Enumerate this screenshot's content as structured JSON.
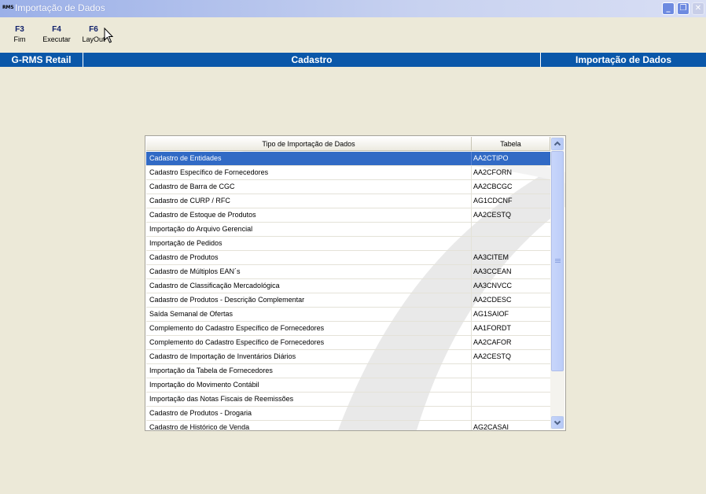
{
  "window": {
    "app_icon_text": "RMS",
    "title": "Importação de Dados",
    "controls": {
      "minimize": "_",
      "maximize": "❐",
      "close": "✕"
    }
  },
  "toolbar": {
    "buttons": [
      {
        "key": "F3",
        "label": "Fim"
      },
      {
        "key": "F4",
        "label": "Executar"
      },
      {
        "key": "F6",
        "label": "LayOut"
      }
    ]
  },
  "header": {
    "left": "G-RMS Retail",
    "center": "Cadastro",
    "right": "Importação de Dados"
  },
  "grid": {
    "columns": [
      "Tipo de Importação de Dados",
      "Tabela"
    ],
    "selected_index": 0,
    "rows": [
      {
        "tipo": "Cadastro de Entidades",
        "tabela": "AA2CTIPO"
      },
      {
        "tipo": "Cadastro Específico de Fornecedores",
        "tabela": "AA2CFORN"
      },
      {
        "tipo": "Cadastro de Barra de CGC",
        "tabela": "AA2CBCGC"
      },
      {
        "tipo": "Cadastro de CURP / RFC",
        "tabela": "AG1CDCNF"
      },
      {
        "tipo": "Cadastro de Estoque de Produtos",
        "tabela": "AA2CESTQ"
      },
      {
        "tipo": "Importação do Arquivo Gerencial",
        "tabela": ""
      },
      {
        "tipo": "Importação de Pedidos",
        "tabela": ""
      },
      {
        "tipo": "Cadastro de Produtos",
        "tabela": "AA3CITEM"
      },
      {
        "tipo": "Cadastro de Múltiplos EAN´s",
        "tabela": "AA3CCEAN"
      },
      {
        "tipo": "Cadastro de Classificação Mercadológica",
        "tabela": "AA3CNVCC"
      },
      {
        "tipo": "Cadastro de Produtos - Descrição Complementar",
        "tabela": "AA2CDESC"
      },
      {
        "tipo": "Saída Semanal de Ofertas",
        "tabela": "AG1SAIOF"
      },
      {
        "tipo": "Complemento do Cadastro Específico de Fornecedores",
        "tabela": "AA1FORDT"
      },
      {
        "tipo": "Complemento do Cadastro Específico de Fornecedores",
        "tabela": "AA2CAFOR"
      },
      {
        "tipo": "Cadastro de Importação de Inventários Diários",
        "tabela": "AA2CESTQ"
      },
      {
        "tipo": "Importação da Tabela de Fornecedores",
        "tabela": ""
      },
      {
        "tipo": "Importação do Movimento Contábil",
        "tabela": ""
      },
      {
        "tipo": "Importação das Notas Fiscais de Reemissões",
        "tabela": ""
      },
      {
        "tipo": "Cadastro de Produtos - Drogaria",
        "tabela": ""
      },
      {
        "tipo": "Cadastro de Histórico de Venda",
        "tabela": "AG2CASAI"
      }
    ]
  },
  "colors": {
    "selection": "#316ac5",
    "header_bar": "#0a57a9",
    "background": "#ece9d8"
  }
}
